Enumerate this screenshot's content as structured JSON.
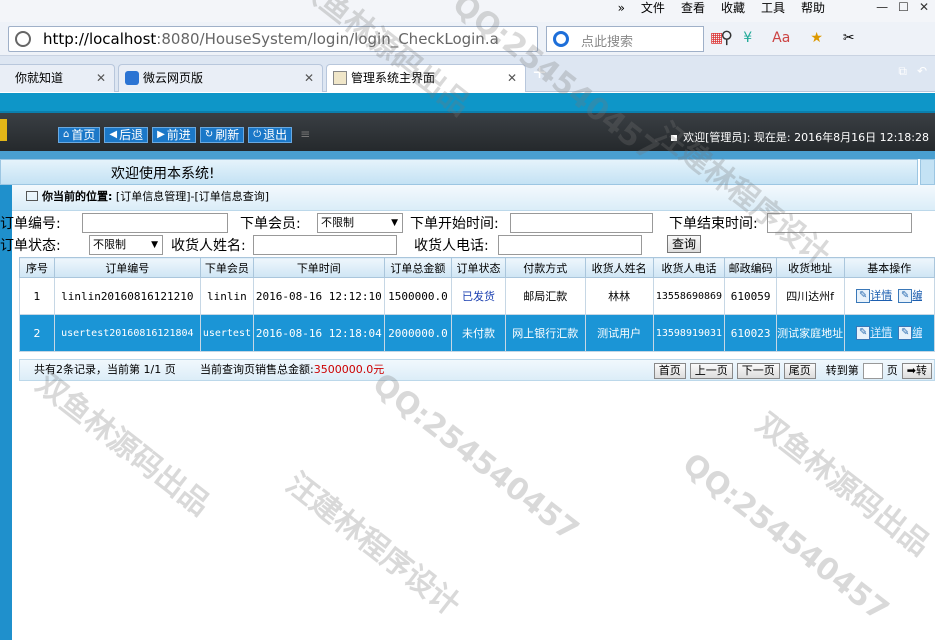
{
  "browser": {
    "menus": [
      "»",
      "文件",
      "查看",
      "收藏",
      "工具",
      "帮助"
    ],
    "url_host": "http://localhost",
    "url_rest": ":8080/HouseSystem/login/login_CheckLogin.a",
    "search_placeholder": "点此搜索",
    "tabs": [
      {
        "label": "你就知道"
      },
      {
        "label": "微云网页版"
      },
      {
        "label": "管理系统主界面"
      }
    ]
  },
  "header": {
    "nav": [
      {
        "label": "首页",
        "icon": "home-icon"
      },
      {
        "label": "后退",
        "icon": "back-icon"
      },
      {
        "label": "前进",
        "icon": "forward-icon"
      },
      {
        "label": "刷新",
        "icon": "refresh-icon"
      },
      {
        "label": "退出",
        "icon": "power-icon"
      }
    ],
    "welcome_text": "欢迎[管理员]: 现在是: 2016年8月16日 12:18:28"
  },
  "welcome_banner": "欢迎使用本系统!",
  "location": {
    "label": "你当前的位置:",
    "path": "[订单信息管理]-[订单信息查询]"
  },
  "filters": {
    "order_no_label": "订单编号:",
    "member_label": "下单会员:",
    "member_value": "不限制",
    "start_label": "下单开始时间:",
    "end_label": "下单结束时间:",
    "status_label": "订单状态:",
    "status_value": "不限制",
    "receiver_label": "收货人姓名:",
    "phone_label": "收货人电话:",
    "query_button": "查询"
  },
  "table": {
    "columns": [
      "序号",
      "订单编号",
      "下单会员",
      "下单时间",
      "订单总金额",
      "订单状态",
      "付款方式",
      "收货人姓名",
      "收货人电话",
      "邮政编码",
      "收货地址",
      "基本操作"
    ],
    "rows": [
      {
        "no": "1",
        "order_no": "linlin20160816121210",
        "member": "linlin",
        "time": "2016-08-16 12:12:10",
        "amount": "1500000.0",
        "status": "已发货",
        "pay": "邮局汇款",
        "receiver": "林林",
        "phone": "13558690869",
        "zip": "610059",
        "address": "四川达州f",
        "op1": "详情",
        "op2": "编"
      },
      {
        "no": "2",
        "order_no": "usertest20160816121804",
        "member": "usertest",
        "time": "2016-08-16 12:18:04",
        "amount": "2000000.0",
        "status": "未付款",
        "pay": "网上银行汇款",
        "receiver": "测试用户",
        "phone": "13598919031",
        "zip": "610023",
        "address": "测试家庭地址",
        "op1": "详情",
        "op2": "编"
      }
    ]
  },
  "pager": {
    "info": "共有2条记录，当前第 1/1 页",
    "sum_label": "当前查询页销售总金额:",
    "sum_value": "3500000.0元",
    "first": "首页",
    "prev": "上一页",
    "next": "下一页",
    "last": "尾页",
    "goto_label": "转到第",
    "page_unit": "页",
    "go": "➡转"
  },
  "watermarks": [
    "双鱼林源码出品",
    "QQ:254540457",
    "汪建林程序设计",
    "QQ:254540457",
    "双鱼林源码出品",
    "汪建林程序设计",
    "QQ:254540457",
    "双鱼林源码出品"
  ]
}
